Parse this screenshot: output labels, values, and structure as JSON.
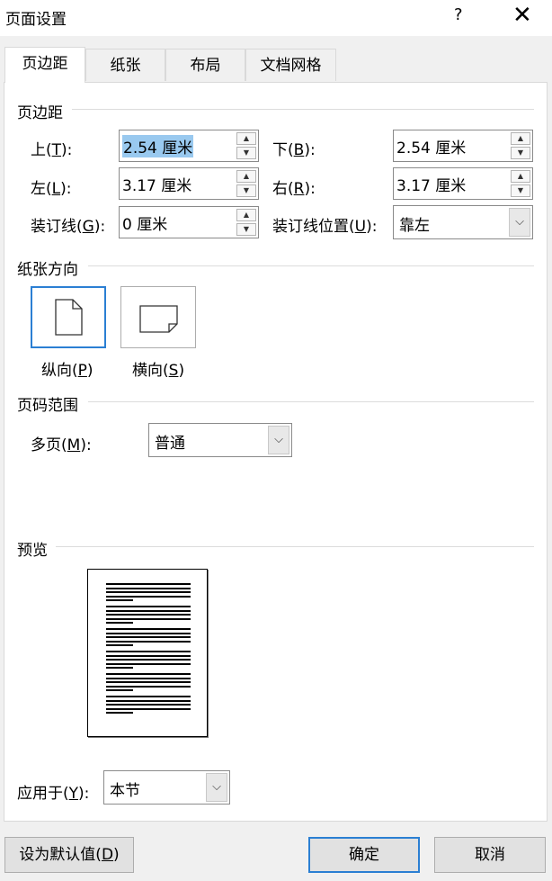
{
  "title": "页面设置",
  "help_label": "?",
  "close_label": "✕",
  "tabs": [
    "页边距",
    "纸张",
    "布局",
    "文档网格"
  ],
  "margins": {
    "section": "页边距",
    "top": {
      "label_pre": "上(",
      "key": "T",
      "label_post": "):",
      "value": "2.54 厘米"
    },
    "bottom": {
      "label_pre": "下(",
      "key": "B",
      "label_post": "):",
      "value": "2.54 厘米"
    },
    "left": {
      "label_pre": "左(",
      "key": "L",
      "label_post": "):",
      "value": "3.17 厘米"
    },
    "right": {
      "label_pre": "右(",
      "key": "R",
      "label_post": "):",
      "value": "3.17 厘米"
    },
    "gutter": {
      "label_pre": "装订线(",
      "key": "G",
      "label_post": "):",
      "value": "0 厘米"
    },
    "gutter_pos": {
      "label_pre": "装订线位置(",
      "key": "U",
      "label_post": "):",
      "value": "靠左"
    }
  },
  "orientation": {
    "section": "纸张方向",
    "portrait": {
      "label_pre": "纵向(",
      "key": "P",
      "label_post": ")"
    },
    "landscape": {
      "label_pre": "横向(",
      "key": "S",
      "label_post": ")"
    },
    "selected": "portrait"
  },
  "pages": {
    "section": "页码范围",
    "multiple": {
      "label_pre": "多页(",
      "key": "M",
      "label_post": "):",
      "value": "普通"
    }
  },
  "preview": {
    "section": "预览"
  },
  "apply_to": {
    "label_pre": "应用于(",
    "key": "Y",
    "label_post": "):",
    "value": "本节"
  },
  "buttons": {
    "default": {
      "label_pre": "设为默认值(",
      "key": "D",
      "label_post": ")"
    },
    "ok": "确定",
    "cancel": "取消"
  },
  "icons": {
    "spin_up": "▲",
    "spin_down": "▼",
    "dropdown": "⌵"
  },
  "colors": {
    "accent": "#2b7fd3",
    "selection": "#99c9ef"
  }
}
